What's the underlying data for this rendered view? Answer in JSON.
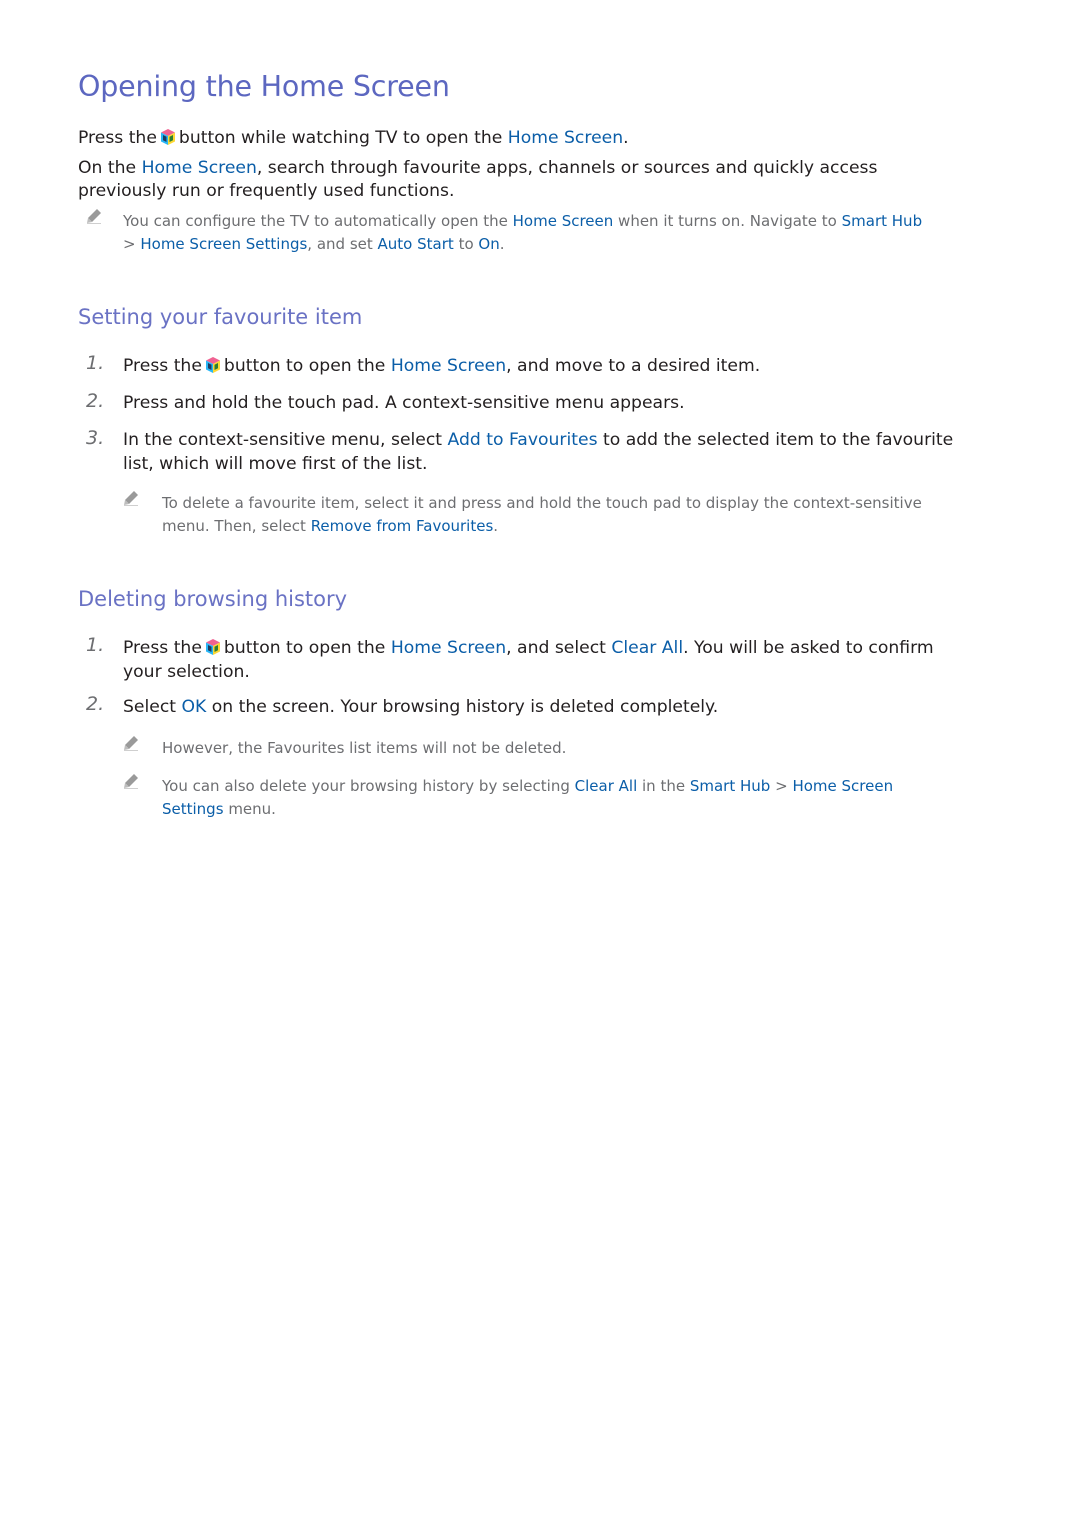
{
  "title": "Opening the Home Screen",
  "intro": {
    "p1": {
      "pre": "Press the",
      "post": "button while watching TV to open the",
      "link": "Home Screen",
      "end": "."
    },
    "p2": {
      "pre": "On the",
      "link": "Home Screen",
      "post": ", search through favourite apps, channels or sources and quickly access",
      "line2": "previously run or frequently used functions."
    },
    "note": {
      "t1": "You can configure the TV to automatically open the",
      "l1": "Home Screen",
      "t2": "when it turns on. Navigate to",
      "l2": "Smart Hub",
      "sep": ">",
      "l3": "Home Screen Settings",
      "t3": ", and set",
      "l4": "Auto Start",
      "t4": "to",
      "l5": "On",
      "t5": "."
    }
  },
  "sections": [
    {
      "heading": "Setting your favourite item",
      "steps": [
        {
          "num": "1.",
          "pre": "Press the",
          "post": "button to open the",
          "link": "Home Screen",
          "end": ", and move to a desired item."
        },
        {
          "num": "2.",
          "text": "Press and hold the touch pad. A context-sensitive menu appears."
        },
        {
          "num": "3.",
          "pre": "In the context-sensitive menu, select",
          "link": "Add to Favourites",
          "post": "to add the selected item to the favourite",
          "line2": "list, which will move first of the list."
        }
      ],
      "note": {
        "t1": "To delete a favourite item, select it and press and hold the touch pad to display the context-sensitive",
        "t2": "menu. Then, select",
        "l1": "Remove from Favourites",
        "t3": "."
      }
    },
    {
      "heading": "Deleting browsing history",
      "steps": [
        {
          "num": "1.",
          "pre": "Press the",
          "post": "button to open the",
          "link": "Home Screen",
          "mid": ", and select",
          "link2": "Clear All",
          "end": ". You will be asked to confirm",
          "line2": "your selection."
        },
        {
          "num": "2.",
          "pre": "Select",
          "link": "OK",
          "post": "on the screen. Your browsing history is deleted completely."
        }
      ],
      "notes": [
        {
          "text": "However, the Favourites list items will not be deleted."
        },
        {
          "t1": "You can also delete your browsing history by selecting",
          "l1": "Clear All",
          "t2": "in the",
          "l2": "Smart Hub",
          "sep": ">",
          "l3": "Home Screen",
          "l4": "Settings",
          "t3": "menu."
        }
      ]
    }
  ],
  "icons": {
    "hub": "smart-hub-icon",
    "note": "pencil-note-icon"
  }
}
